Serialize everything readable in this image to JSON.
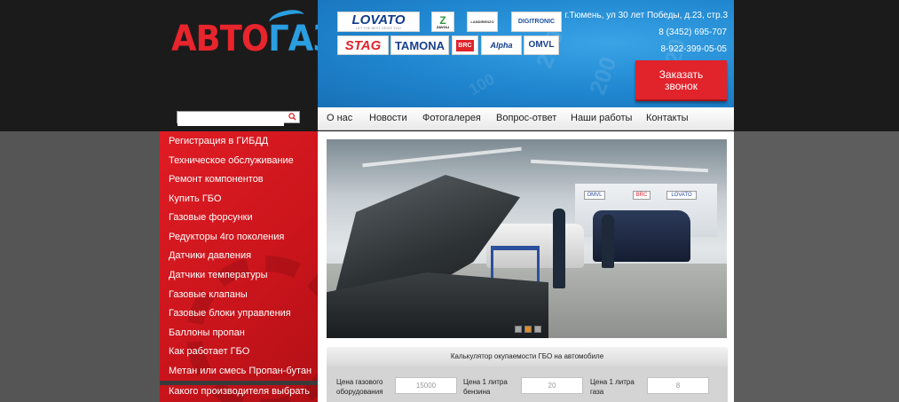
{
  "logo": {
    "part1": "АВТО",
    "part2": "ГАЗ"
  },
  "search": {
    "value": "",
    "placeholder": ""
  },
  "brands": [
    {
      "name": "LOVATO",
      "sub": "LET THE BEST DRIVE YOU",
      "color": "#123c8c"
    },
    {
      "name": "Z",
      "sub": "ZAVOLI",
      "color": "#2f9a3a"
    },
    {
      "name": "LANDIRENZO",
      "sub": "",
      "color": "#333333"
    },
    {
      "name": "DIGITRONIC",
      "sub": "",
      "color": "#1a4f9e"
    },
    {
      "name": "STAG",
      "sub": "",
      "color": "#e1232b"
    },
    {
      "name": "TAMONA",
      "sub": "",
      "color": "#1a3f8c"
    },
    {
      "name": "BRC",
      "sub": "",
      "color": "#e1232b"
    },
    {
      "name": "Alpha",
      "sub": "",
      "color": "#123c8c"
    },
    {
      "name": "OMVL",
      "sub": "",
      "color": "#1a3f8c"
    }
  ],
  "contact": {
    "address": "г.Тюмень, ул 30 лет Победы, д.23, стр.3",
    "phone1": "8 (3452) 695-707",
    "phone2": "8-922-399-05-05"
  },
  "order_button": {
    "label_line1": "Заказать",
    "label_line2": "звонок"
  },
  "nav": [
    {
      "label": "О нас"
    },
    {
      "label": "Новости"
    },
    {
      "label": "Фотогалерея"
    },
    {
      "label": "Вопрос-ответ"
    },
    {
      "label": "Наши работы"
    },
    {
      "label": "Контакты"
    }
  ],
  "sidebar": [
    {
      "label": "Регистрация в ГИБДД"
    },
    {
      "label": "Техническое обслуживание"
    },
    {
      "label": "Ремонт компонентов"
    },
    {
      "label": "Купить ГБО"
    },
    {
      "label": "Газовые форсунки"
    },
    {
      "label": "Редукторы 4го поколения"
    },
    {
      "label": "Датчики давления"
    },
    {
      "label": "Датчики температуры"
    },
    {
      "label": "Газовые клапаны"
    },
    {
      "label": "Газовые блоки управления"
    },
    {
      "label": "Баллоны пропан"
    },
    {
      "label": "Как работает ГБО"
    },
    {
      "label": "Метан или смесь Пропан-бутан"
    },
    {
      "label": "Какого производителя выбрать"
    }
  ],
  "calculator": {
    "title": "Калькулятор окупаемости ГБО на автомобиле",
    "fields": [
      {
        "label_line1": "Цена газового",
        "label_line2": "оборудования",
        "value": "15000"
      },
      {
        "label_line1": "Цена 1 литра",
        "label_line2": "бензина",
        "value": "20"
      },
      {
        "label_line1": "Цена 1 литра",
        "label_line2": "газа",
        "value": "8"
      }
    ]
  },
  "slider": {
    "slide_count": 3,
    "active_slide": 1
  }
}
